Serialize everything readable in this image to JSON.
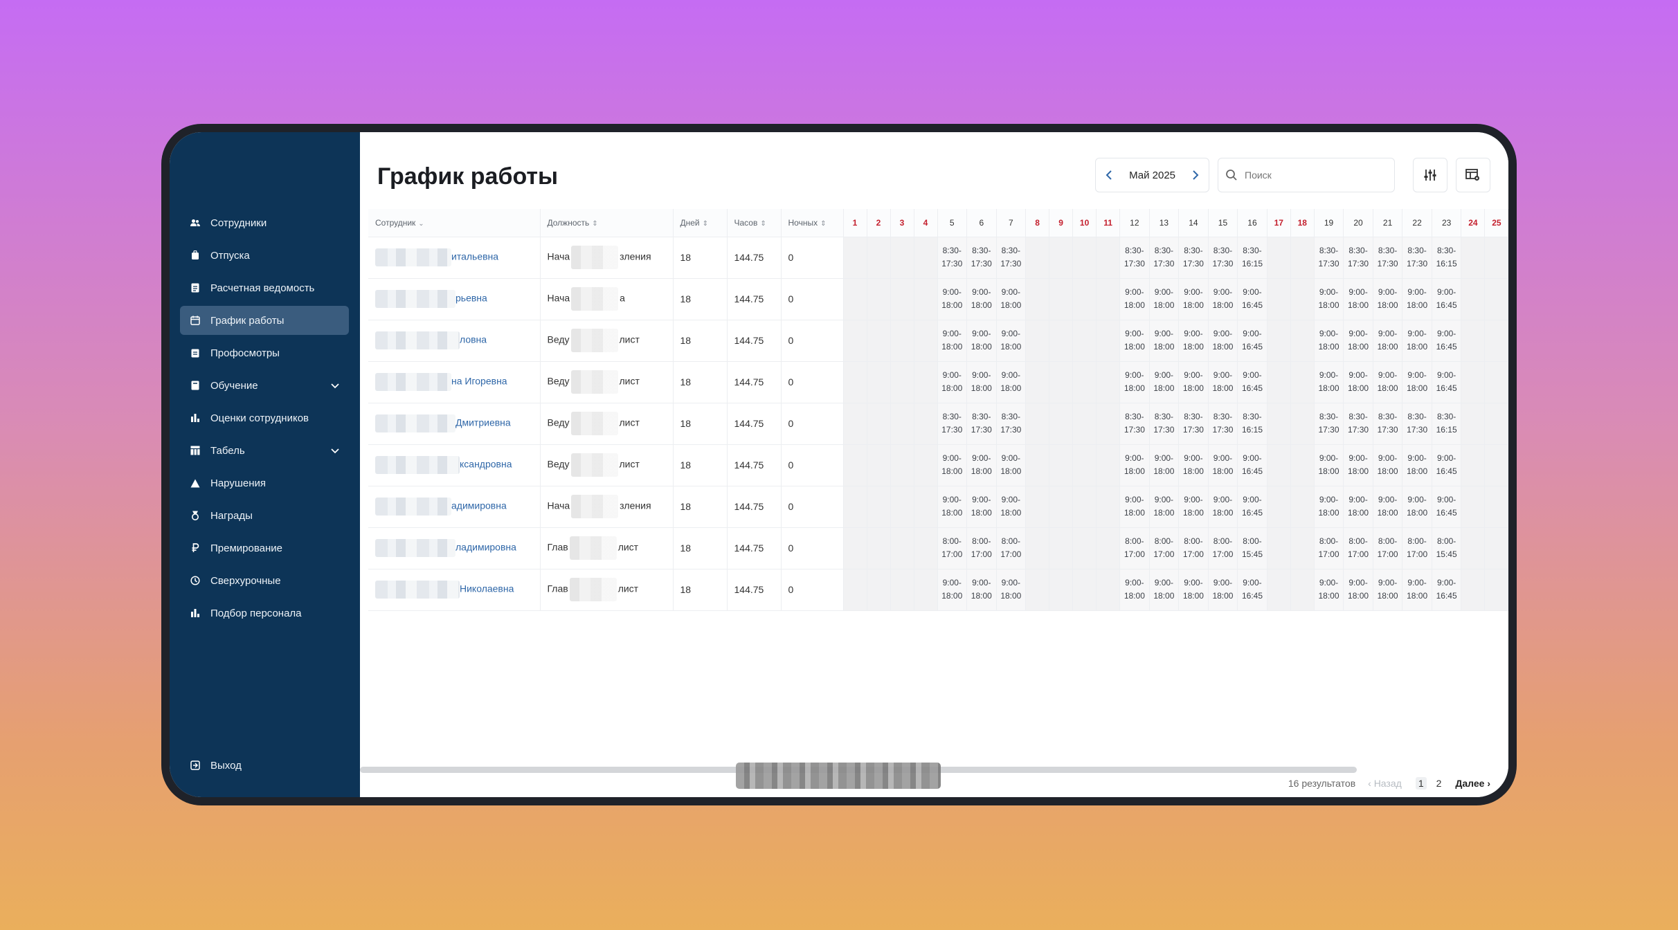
{
  "sidebar": {
    "items": [
      {
        "label": "Сотрудники",
        "icon": "people-icon"
      },
      {
        "label": "Отпуска",
        "icon": "luggage-icon"
      },
      {
        "label": "Расчетная ведомость",
        "icon": "document-icon"
      },
      {
        "label": "График работы",
        "icon": "calendar-icon",
        "active": true
      },
      {
        "label": "Профосмотры",
        "icon": "clipboard-icon"
      },
      {
        "label": "Обучение",
        "icon": "book-icon",
        "expandable": true
      },
      {
        "label": "Оценки сотрудников",
        "icon": "bar-chart-icon"
      },
      {
        "label": "Табель",
        "icon": "table-icon",
        "expandable": true
      },
      {
        "label": "Нарушения",
        "icon": "warning-icon"
      },
      {
        "label": "Награды",
        "icon": "medal-icon"
      },
      {
        "label": "Премирование",
        "icon": "ruble-icon"
      },
      {
        "label": "Сверхурочные",
        "icon": "clock-icon"
      },
      {
        "label": "Подбор персонала",
        "icon": "bar-chart-icon"
      }
    ],
    "logout": "Выход"
  },
  "header": {
    "title": "График работы",
    "month": "Май 2025",
    "search_placeholder": "Поиск"
  },
  "table": {
    "columns": {
      "employee": "Сотрудник",
      "position": "Должность",
      "days": "Дней",
      "hours": "Часов",
      "night": "Ночных"
    },
    "days": [
      "1",
      "2",
      "3",
      "4",
      "5",
      "6",
      "7",
      "8",
      "9",
      "10",
      "11",
      "12",
      "13",
      "14",
      "15",
      "16",
      "17",
      "18",
      "19",
      "20",
      "21",
      "22",
      "23",
      "24",
      "25"
    ],
    "weekend_days": [
      "1",
      "2",
      "3",
      "4",
      "8",
      "9",
      "10",
      "11",
      "17",
      "18",
      "24",
      "25"
    ],
    "rows": [
      {
        "name": "итальевна",
        "position": [
          "Нача",
          "зления"
        ],
        "days": "18",
        "hours": "144.75",
        "night": "0",
        "shifts": {
          "5": [
            "8:30-",
            "17:30"
          ],
          "6": [
            "8:30-",
            "17:30"
          ],
          "7": [
            "8:30-",
            "17:30"
          ],
          "12": [
            "8:30-",
            "17:30"
          ],
          "13": [
            "8:30-",
            "17:30"
          ],
          "14": [
            "8:30-",
            "17:30"
          ],
          "15": [
            "8:30-",
            "17:30"
          ],
          "16": [
            "8:30-",
            "16:15"
          ],
          "19": [
            "8:30-",
            "17:30"
          ],
          "20": [
            "8:30-",
            "17:30"
          ],
          "21": [
            "8:30-",
            "17:30"
          ],
          "22": [
            "8:30-",
            "17:30"
          ],
          "23": [
            "8:30-",
            "16:15"
          ]
        }
      },
      {
        "name": "рьевна",
        "position": [
          "Нача",
          "а"
        ],
        "days": "18",
        "hours": "144.75",
        "night": "0",
        "shifts": {
          "5": [
            "9:00-",
            "18:00"
          ],
          "6": [
            "9:00-",
            "18:00"
          ],
          "7": [
            "9:00-",
            "18:00"
          ],
          "12": [
            "9:00-",
            "18:00"
          ],
          "13": [
            "9:00-",
            "18:00"
          ],
          "14": [
            "9:00-",
            "18:00"
          ],
          "15": [
            "9:00-",
            "18:00"
          ],
          "16": [
            "9:00-",
            "16:45"
          ],
          "19": [
            "9:00-",
            "18:00"
          ],
          "20": [
            "9:00-",
            "18:00"
          ],
          "21": [
            "9:00-",
            "18:00"
          ],
          "22": [
            "9:00-",
            "18:00"
          ],
          "23": [
            "9:00-",
            "16:45"
          ]
        }
      },
      {
        "name": "ловна",
        "position": [
          "Веду",
          "лист"
        ],
        "days": "18",
        "hours": "144.75",
        "night": "0",
        "shifts": {
          "5": [
            "9:00-",
            "18:00"
          ],
          "6": [
            "9:00-",
            "18:00"
          ],
          "7": [
            "9:00-",
            "18:00"
          ],
          "12": [
            "9:00-",
            "18:00"
          ],
          "13": [
            "9:00-",
            "18:00"
          ],
          "14": [
            "9:00-",
            "18:00"
          ],
          "15": [
            "9:00-",
            "18:00"
          ],
          "16": [
            "9:00-",
            "16:45"
          ],
          "19": [
            "9:00-",
            "18:00"
          ],
          "20": [
            "9:00-",
            "18:00"
          ],
          "21": [
            "9:00-",
            "18:00"
          ],
          "22": [
            "9:00-",
            "18:00"
          ],
          "23": [
            "9:00-",
            "16:45"
          ]
        }
      },
      {
        "name": "на Игоревна",
        "position": [
          "Веду",
          "лист"
        ],
        "days": "18",
        "hours": "144.75",
        "night": "0",
        "shifts": {
          "5": [
            "9:00-",
            "18:00"
          ],
          "6": [
            "9:00-",
            "18:00"
          ],
          "7": [
            "9:00-",
            "18:00"
          ],
          "12": [
            "9:00-",
            "18:00"
          ],
          "13": [
            "9:00-",
            "18:00"
          ],
          "14": [
            "9:00-",
            "18:00"
          ],
          "15": [
            "9:00-",
            "18:00"
          ],
          "16": [
            "9:00-",
            "16:45"
          ],
          "19": [
            "9:00-",
            "18:00"
          ],
          "20": [
            "9:00-",
            "18:00"
          ],
          "21": [
            "9:00-",
            "18:00"
          ],
          "22": [
            "9:00-",
            "18:00"
          ],
          "23": [
            "9:00-",
            "16:45"
          ]
        }
      },
      {
        "name": "Дмитриевна",
        "position": [
          "Веду",
          "лист"
        ],
        "days": "18",
        "hours": "144.75",
        "night": "0",
        "shifts": {
          "5": [
            "8:30-",
            "17:30"
          ],
          "6": [
            "8:30-",
            "17:30"
          ],
          "7": [
            "8:30-",
            "17:30"
          ],
          "12": [
            "8:30-",
            "17:30"
          ],
          "13": [
            "8:30-",
            "17:30"
          ],
          "14": [
            "8:30-",
            "17:30"
          ],
          "15": [
            "8:30-",
            "17:30"
          ],
          "16": [
            "8:30-",
            "16:15"
          ],
          "19": [
            "8:30-",
            "17:30"
          ],
          "20": [
            "8:30-",
            "17:30"
          ],
          "21": [
            "8:30-",
            "17:30"
          ],
          "22": [
            "8:30-",
            "17:30"
          ],
          "23": [
            "8:30-",
            "16:15"
          ]
        }
      },
      {
        "name": "ксандровна",
        "position": [
          "Веду",
          "лист"
        ],
        "days": "18",
        "hours": "144.75",
        "night": "0",
        "shifts": {
          "5": [
            "9:00-",
            "18:00"
          ],
          "6": [
            "9:00-",
            "18:00"
          ],
          "7": [
            "9:00-",
            "18:00"
          ],
          "12": [
            "9:00-",
            "18:00"
          ],
          "13": [
            "9:00-",
            "18:00"
          ],
          "14": [
            "9:00-",
            "18:00"
          ],
          "15": [
            "9:00-",
            "18:00"
          ],
          "16": [
            "9:00-",
            "16:45"
          ],
          "19": [
            "9:00-",
            "18:00"
          ],
          "20": [
            "9:00-",
            "18:00"
          ],
          "21": [
            "9:00-",
            "18:00"
          ],
          "22": [
            "9:00-",
            "18:00"
          ],
          "23": [
            "9:00-",
            "16:45"
          ]
        }
      },
      {
        "name": "адимировна",
        "position": [
          "Нача",
          "зления"
        ],
        "days": "18",
        "hours": "144.75",
        "night": "0",
        "shifts": {
          "5": [
            "9:00-",
            "18:00"
          ],
          "6": [
            "9:00-",
            "18:00"
          ],
          "7": [
            "9:00-",
            "18:00"
          ],
          "12": [
            "9:00-",
            "18:00"
          ],
          "13": [
            "9:00-",
            "18:00"
          ],
          "14": [
            "9:00-",
            "18:00"
          ],
          "15": [
            "9:00-",
            "18:00"
          ],
          "16": [
            "9:00-",
            "16:45"
          ],
          "19": [
            "9:00-",
            "18:00"
          ],
          "20": [
            "9:00-",
            "18:00"
          ],
          "21": [
            "9:00-",
            "18:00"
          ],
          "22": [
            "9:00-",
            "18:00"
          ],
          "23": [
            "9:00-",
            "16:45"
          ]
        }
      },
      {
        "name": "ладимировна",
        "position": [
          "Глав",
          "лист"
        ],
        "days": "18",
        "hours": "144.75",
        "night": "0",
        "shifts": {
          "5": [
            "8:00-",
            "17:00"
          ],
          "6": [
            "8:00-",
            "17:00"
          ],
          "7": [
            "8:00-",
            "17:00"
          ],
          "12": [
            "8:00-",
            "17:00"
          ],
          "13": [
            "8:00-",
            "17:00"
          ],
          "14": [
            "8:00-",
            "17:00"
          ],
          "15": [
            "8:00-",
            "17:00"
          ],
          "16": [
            "8:00-",
            "15:45"
          ],
          "19": [
            "8:00-",
            "17:00"
          ],
          "20": [
            "8:00-",
            "17:00"
          ],
          "21": [
            "8:00-",
            "17:00"
          ],
          "22": [
            "8:00-",
            "17:00"
          ],
          "23": [
            "8:00-",
            "15:45"
          ]
        }
      },
      {
        "name": "Николаевна",
        "position": [
          "Глав",
          "лист"
        ],
        "days": "18",
        "hours": "144.75",
        "night": "0",
        "shifts": {
          "5": [
            "9:00-",
            "18:00"
          ],
          "6": [
            "9:00-",
            "18:00"
          ],
          "7": [
            "9:00-",
            "18:00"
          ],
          "12": [
            "9:00-",
            "18:00"
          ],
          "13": [
            "9:00-",
            "18:00"
          ],
          "14": [
            "9:00-",
            "18:00"
          ],
          "15": [
            "9:00-",
            "18:00"
          ],
          "16": [
            "9:00-",
            "16:45"
          ],
          "19": [
            "9:00-",
            "18:00"
          ],
          "20": [
            "9:00-",
            "18:00"
          ],
          "21": [
            "9:00-",
            "18:00"
          ],
          "22": [
            "9:00-",
            "18:00"
          ],
          "23": [
            "9:00-",
            "16:45"
          ]
        }
      }
    ]
  },
  "pagination": {
    "results": "16 результатов",
    "prev": "‹ Назад",
    "pages": [
      "1",
      "2"
    ],
    "current": "1",
    "next": "Далее ›"
  },
  "colors": {
    "sidebar_bg": "#0d3457",
    "sidebar_active": "#3a5c7e",
    "weekend_day": "#c4202e",
    "link": "#2f67a8"
  }
}
